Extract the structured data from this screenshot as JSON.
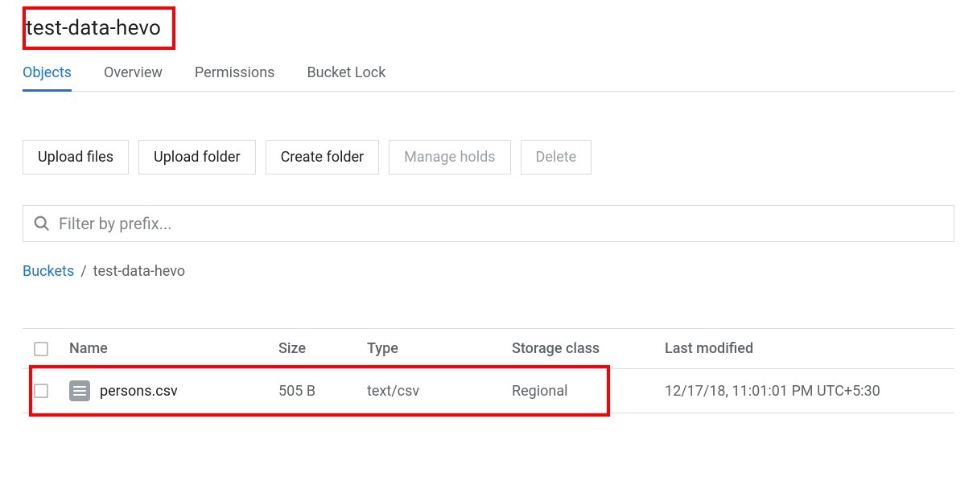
{
  "title": "test-data-hevo",
  "tabs": [
    {
      "label": "Objects",
      "active": true
    },
    {
      "label": "Overview",
      "active": false
    },
    {
      "label": "Permissions",
      "active": false
    },
    {
      "label": "Bucket Lock",
      "active": false
    }
  ],
  "toolbar": {
    "upload_files": "Upload files",
    "upload_folder": "Upload folder",
    "create_folder": "Create folder",
    "manage_holds": "Manage holds",
    "delete": "Delete"
  },
  "filter": {
    "placeholder": "Filter by prefix..."
  },
  "breadcrumb": {
    "root": "Buckets",
    "separator": "/",
    "current": "test-data-hevo"
  },
  "table": {
    "headers": {
      "name": "Name",
      "size": "Size",
      "type": "Type",
      "storage_class": "Storage class",
      "last_modified": "Last modified"
    },
    "rows": [
      {
        "name": "persons.csv",
        "size": "505 B",
        "type": "text/csv",
        "storage_class": "Regional",
        "last_modified": "12/17/18, 11:01:01 PM UTC+5:30"
      }
    ]
  }
}
